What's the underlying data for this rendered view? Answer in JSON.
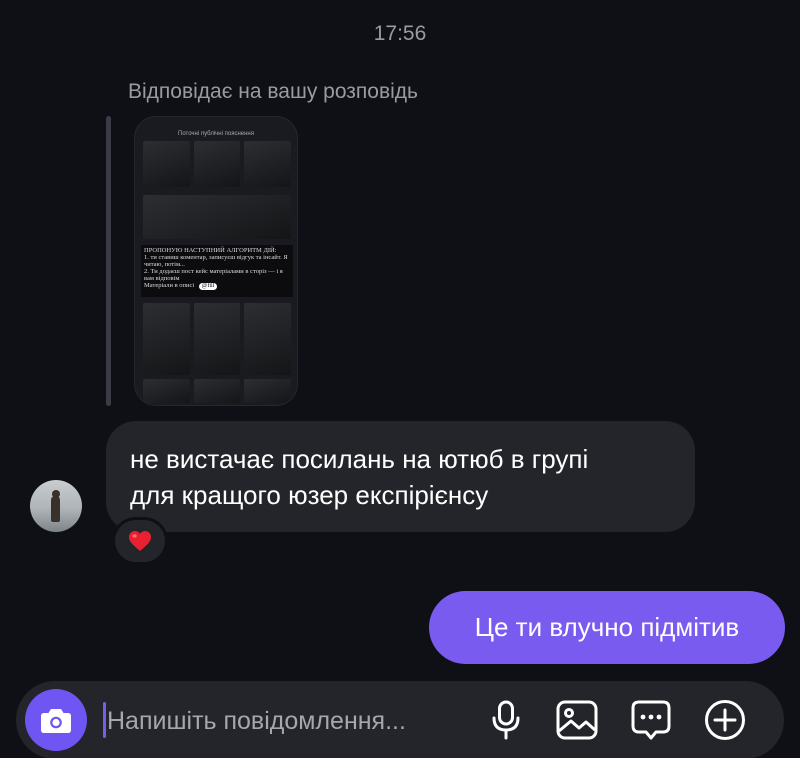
{
  "header": {
    "timestamp": "17:56"
  },
  "reply": {
    "label": "Відповідає на вашу розповідь",
    "story_preview": {
      "title": "Поточні публічні пояснення",
      "heading": "ПРОПОНУЮ НАСТУПНИЙ АЛГОРИТМ ДІЙ:",
      "line1": "1. ти ставиш коментар, записуєш відгук та інсайт. Я читаю, потім...",
      "line2": "2. Ти додаєш пост кейс матеріалами в сторіз — і я вам відповім",
      "footer": "Матеріали в описі",
      "pill": "@fill"
    }
  },
  "messages": {
    "incoming": {
      "line1": "не вистачає посилань на ютюб в групі",
      "line2": "для кращого юзер експірієнсу",
      "reaction": "❤️"
    },
    "outgoing": {
      "text": "Це ти влучно підмітив"
    }
  },
  "composer": {
    "placeholder": "Напишіть повідомлення...",
    "icons": [
      "camera-icon",
      "microphone-icon",
      "image-icon",
      "sticker-icon",
      "plus-icon"
    ]
  },
  "colors": {
    "background": "#0f1016",
    "bubble_in": "#24252b",
    "bubble_out": "#7a5bf0",
    "accent": "#6f56f2"
  }
}
